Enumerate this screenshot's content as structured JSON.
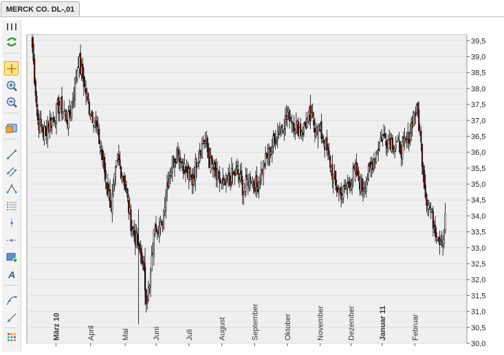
{
  "tab": {
    "label": "MERCK CO. DL-,01"
  },
  "toolbar": {
    "buttons": [
      {
        "name": "refresh-button",
        "icon": "refresh-icon"
      },
      {
        "name": "crosshair-button",
        "icon": "crosshair-icon",
        "active": true
      },
      {
        "name": "zoom-in-button",
        "icon": "zoom-in-icon"
      },
      {
        "name": "zoom-out-button",
        "icon": "zoom-out-icon"
      },
      {
        "name": "chart-settings-button",
        "icon": "chart-window-icon"
      },
      {
        "name": "line-tool-button",
        "icon": "line-icon"
      },
      {
        "name": "channel-tool-button",
        "icon": "channel-icon"
      },
      {
        "name": "triangle-tool-button",
        "icon": "triangle-icon"
      },
      {
        "name": "fibonacci-tool-button",
        "icon": "levels-icon"
      },
      {
        "name": "vertical-line-button",
        "icon": "vertical-line-icon"
      },
      {
        "name": "horizontal-line-button",
        "icon": "horizontal-line-icon"
      },
      {
        "name": "rectangle-tool-button",
        "icon": "rectangle-icon"
      },
      {
        "name": "text-tool-button",
        "icon": "text-icon"
      },
      {
        "name": "arc-tool-button",
        "icon": "arc-icon"
      },
      {
        "name": "ray-tool-button",
        "icon": "ray-icon"
      },
      {
        "name": "color-palette-button",
        "icon": "palette-icon"
      }
    ]
  },
  "colors": {
    "up": "#ffffff",
    "down": "#8b1a1a",
    "wick": "#000000",
    "plot_bg": "#efefef"
  },
  "chart_data": {
    "type": "candlestick",
    "y_ticks": [
      "39,5",
      "39,0",
      "38,5",
      "38,0",
      "37,5",
      "37,0",
      "36,5",
      "36,0",
      "35,5",
      "35,0",
      "34,5",
      "34,0",
      "33,5",
      "33,0",
      "32,5",
      "32,0",
      "31,5",
      "31,0",
      "30,5",
      "30,0"
    ],
    "ylim": [
      30.0,
      39.7
    ],
    "x_labels": [
      {
        "label": "März 10",
        "bold": true,
        "t": 0.08
      },
      {
        "label": "April",
        "bold": false,
        "t": 0.175
      },
      {
        "label": "Mai",
        "bold": false,
        "t": 0.27
      },
      {
        "label": "Juni",
        "bold": false,
        "t": 0.355
      },
      {
        "label": "Juli",
        "bold": false,
        "t": 0.445
      },
      {
        "label": "August",
        "bold": false,
        "t": 0.535
      },
      {
        "label": "September",
        "bold": false,
        "t": 0.625
      },
      {
        "label": "Oktober",
        "bold": false,
        "t": 0.715
      },
      {
        "label": "November",
        "bold": false,
        "t": 0.805
      },
      {
        "label": "Dezember",
        "bold": false,
        "t": 0.89
      },
      {
        "label": "Januar 11",
        "bold": true,
        "t": 0.975
      },
      {
        "label": "Februar",
        "bold": false,
        "t": 1.065
      }
    ],
    "keypoints": [
      [
        0,
        39.3
      ],
      [
        5,
        37.0
      ],
      [
        10,
        36.6
      ],
      [
        18,
        37.0
      ],
      [
        25,
        37.5
      ],
      [
        33,
        37.0
      ],
      [
        38,
        37.9
      ],
      [
        42,
        38.9
      ],
      [
        47,
        38.2
      ],
      [
        52,
        37.4
      ],
      [
        58,
        36.9
      ],
      [
        63,
        36.0
      ],
      [
        68,
        35.0
      ],
      [
        72,
        34.3
      ],
      [
        78,
        35.8
      ],
      [
        84,
        35.1
      ],
      [
        90,
        33.8
      ],
      [
        95,
        33.2
      ],
      [
        100,
        32.7
      ],
      [
        104,
        31.5
      ],
      [
        107,
        31.7
      ],
      [
        112,
        33.8
      ],
      [
        118,
        33.6
      ],
      [
        122,
        34.8
      ],
      [
        128,
        35.7
      ],
      [
        133,
        36.1
      ],
      [
        140,
        35.4
      ],
      [
        146,
        35.1
      ],
      [
        151,
        35.9
      ],
      [
        157,
        36.4
      ],
      [
        163,
        35.6
      ],
      [
        169,
        35.2
      ],
      [
        175,
        34.9
      ],
      [
        181,
        35.2
      ],
      [
        187,
        35.4
      ],
      [
        193,
        34.8
      ],
      [
        199,
        35.3
      ],
      [
        205,
        34.9
      ],
      [
        211,
        35.6
      ],
      [
        217,
        36.0
      ],
      [
        223,
        36.6
      ],
      [
        229,
        36.9
      ],
      [
        235,
        37.2
      ],
      [
        241,
        36.8
      ],
      [
        247,
        36.7
      ],
      [
        253,
        37.1
      ],
      [
        259,
        36.8
      ],
      [
        265,
        36.5
      ],
      [
        271,
        35.8
      ],
      [
        277,
        34.9
      ],
      [
        283,
        34.7
      ],
      [
        289,
        35.0
      ],
      [
        295,
        35.4
      ],
      [
        301,
        34.9
      ],
      [
        307,
        35.3
      ],
      [
        313,
        35.9
      ],
      [
        319,
        36.5
      ],
      [
        325,
        36.4
      ],
      [
        331,
        36.3
      ],
      [
        337,
        36.1
      ],
      [
        343,
        36.4
      ],
      [
        349,
        37.3
      ],
      [
        352,
        37.2
      ],
      [
        355,
        36.2
      ],
      [
        359,
        34.7
      ],
      [
        364,
        34.1
      ],
      [
        368,
        33.6
      ],
      [
        372,
        33.3
      ],
      [
        375,
        33.3
      ],
      [
        377,
        33.9
      ]
    ]
  }
}
